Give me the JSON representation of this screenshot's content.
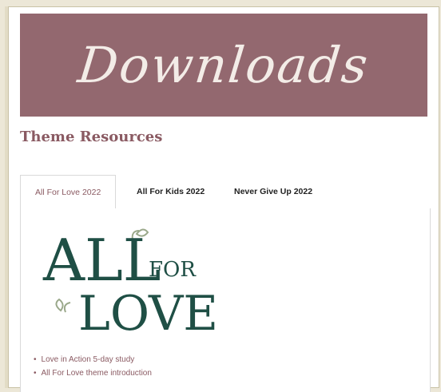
{
  "banner": {
    "title": "Downloads"
  },
  "section": {
    "title": "Theme Resources"
  },
  "tabs": [
    {
      "label": "All For Love 2022",
      "active": true
    },
    {
      "label": "All For Kids 2022",
      "active": false
    },
    {
      "label": "Never Give Up 2022",
      "active": false
    }
  ],
  "logo": {
    "line1": "ALL",
    "line2": "FOR",
    "line3": "LOVE",
    "color": "#1f4f45"
  },
  "resources": [
    {
      "label": "Love in Action 5-day study"
    },
    {
      "label": "All For Love theme introduction"
    }
  ],
  "colors": {
    "accent": "#93686f",
    "text_accent": "#8a5a62",
    "logo_green": "#1f4f45",
    "leaf": "#9aa88a"
  }
}
